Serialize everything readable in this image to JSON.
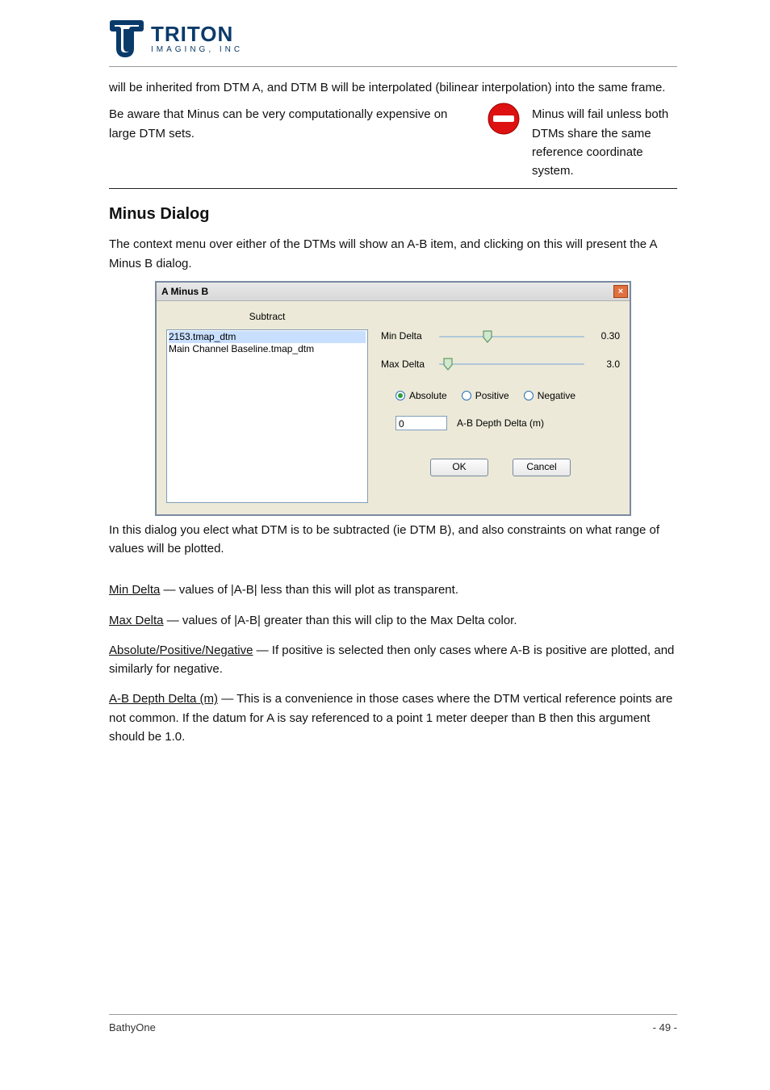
{
  "logo": {
    "name": "TRITON",
    "sub": "IMAGING, INC"
  },
  "intro_para": "will be inherited from DTM A, and DTM B will be interpolated (bilinear interpolation) into the same frame.",
  "warning_left": "Be aware that Minus can be very computationally expensive on large DTM sets.",
  "noentry_icon": "⛔",
  "warning_right": "Minus will fail unless both DTMs share the same reference coordinate system.",
  "subhead": "Minus Dialog",
  "para2": "The context menu over either of the DTMs will show an A-B item, and clicking on this will present the A Minus B dialog.",
  "dialog": {
    "title": "A Minus B",
    "subtract_label": "Subtract",
    "list": {
      "items": [
        "2153.tmap_dtm",
        "Main Channel Baseline.tmap_dtm"
      ],
      "selected": 0
    },
    "min_delta": {
      "label": "Min Delta",
      "value": "0.30",
      "pos": 30
    },
    "max_delta": {
      "label": "Max Delta",
      "value": "3.0",
      "pos": 3
    },
    "radios": {
      "absolute": "Absolute",
      "positive": "Positive",
      "negative": "Negative",
      "selected": "absolute"
    },
    "depth": {
      "value": "0",
      "label": "A-B Depth Delta (m)"
    },
    "ok": "OK",
    "cancel": "Cancel"
  },
  "dialog_caption": "In this dialog you elect what DTM is to be subtracted (ie DTM B), and also constraints on what range of values will be plotted.",
  "spec": {
    "min_delta": {
      "label": "Min Delta",
      "desc": " — values of |A-B| less than this will plot as transparent."
    },
    "max_delta": {
      "label": "Max Delta",
      "desc": " — values of |A-B| greater than this will clip to the Max Delta color."
    },
    "radios": {
      "label": "Absolute/Positive/Negative",
      "desc": " — If positive is selected then only cases where A-B is positive are plotted, and similarly for negative."
    },
    "depth": {
      "label": "A-B Depth Delta (m)",
      "desc": " — This is a convenience in those cases where the DTM vertical reference points are not common. If the datum for A is say referenced to a point 1 meter deeper than B then this argument should be 1.0."
    }
  },
  "footer": {
    "left": "BathyOne",
    "right": "- 49 -"
  }
}
